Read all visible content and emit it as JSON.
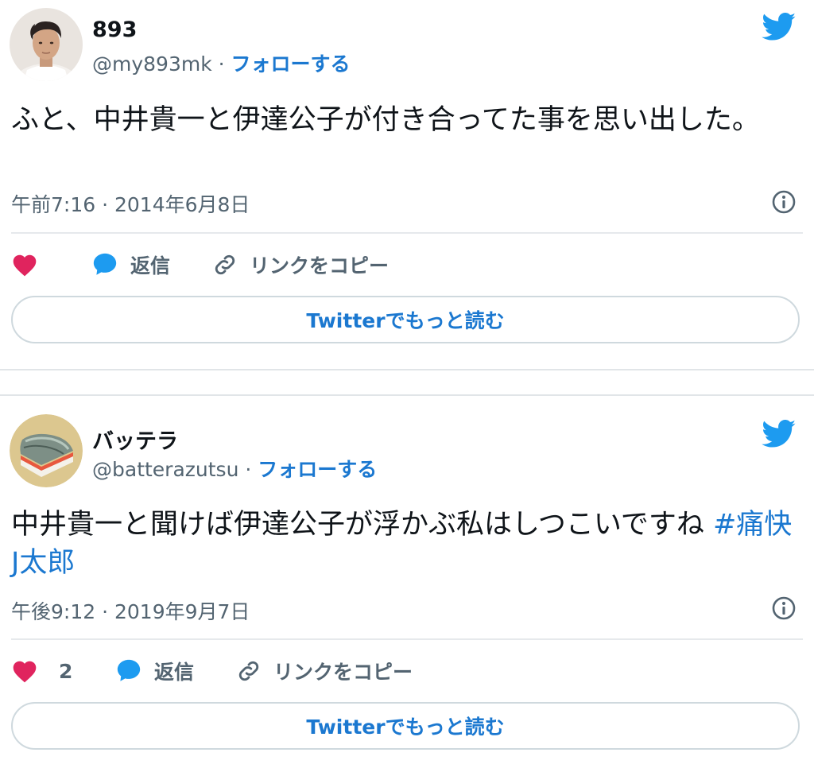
{
  "colors": {
    "link": "#1b78d0",
    "twitter_blue": "#1d9bf0",
    "like_pink": "#e0245e",
    "muted": "#536471"
  },
  "tweets": [
    {
      "author_name": "893",
      "author_handle": "@my893mk",
      "separator": " · ",
      "follow_label": "フォローする",
      "text": "ふと、中井貴一と伊達公子が付き合ってた事を思い出した。",
      "hashtag": "",
      "timestamp": "午前7:16 · 2014年6月8日",
      "like_count": "",
      "reply_label": "返信",
      "copy_link_label": "リンクをコピー",
      "read_more_label": "Twitterでもっと読む",
      "avatar_icon": "person-photo-avatar",
      "brand_icon": "twitter-bird-icon",
      "info_icon": "info-icon"
    },
    {
      "author_name": "バッテラ",
      "author_handle": "@batterazutsu",
      "separator": " · ",
      "follow_label": "フォローする",
      "text": "中井貴一と聞けば伊達公子が浮かぶ私はしつこいですね ",
      "hashtag": "#痛快J太郎",
      "timestamp": "午後9:12 · 2019年9月7日",
      "like_count": "2",
      "reply_label": "返信",
      "copy_link_label": "リンクをコピー",
      "read_more_label": "Twitterでもっと読む",
      "avatar_icon": "battera-sushi-avatar",
      "brand_icon": "twitter-bird-icon",
      "info_icon": "info-icon"
    }
  ]
}
